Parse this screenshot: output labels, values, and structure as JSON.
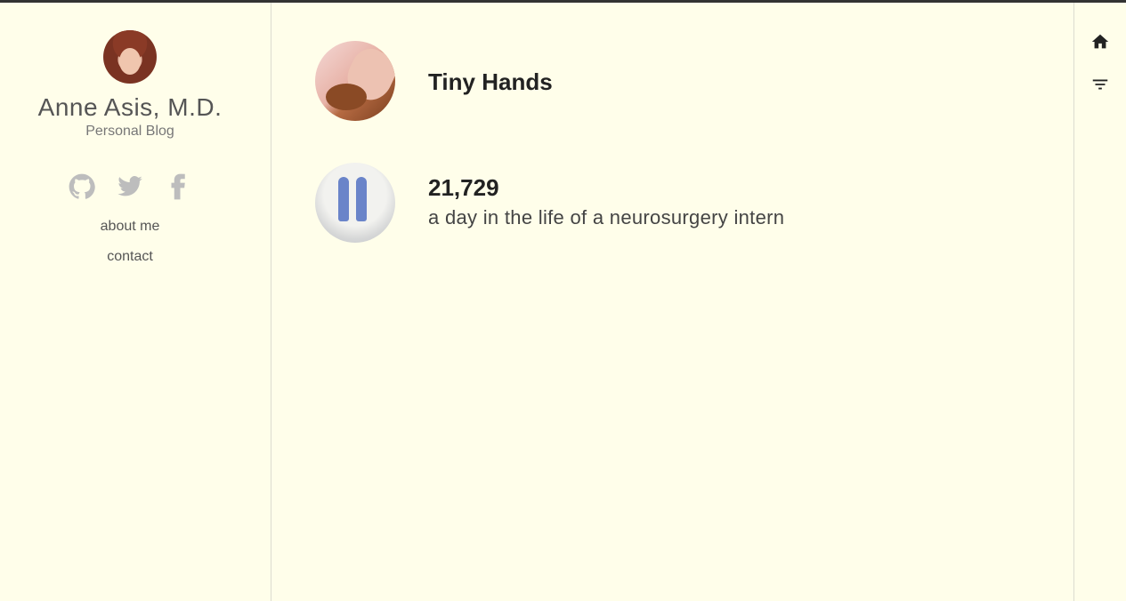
{
  "sidebar": {
    "name": "Anne Asis, M.D.",
    "subtitle": "Personal Blog",
    "social_icons": [
      "github-icon",
      "twitter-icon",
      "facebook-icon"
    ],
    "links": [
      {
        "label": "about me"
      },
      {
        "label": "contact"
      }
    ]
  },
  "posts": [
    {
      "title": "Tiny Hands",
      "subtitle": ""
    },
    {
      "title": "21,729",
      "subtitle": "a day in the life of a neurosurgery intern"
    }
  ],
  "rail": {
    "icons": [
      "home-icon",
      "filter-icon"
    ]
  },
  "colors": {
    "background": "#fffeea",
    "top_bar": "#333333",
    "icon_muted": "#bdbdbd"
  }
}
